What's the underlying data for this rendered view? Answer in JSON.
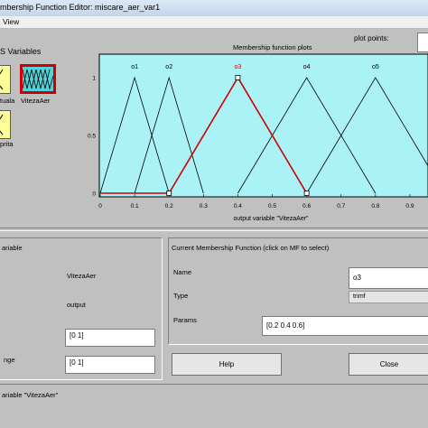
{
  "window": {
    "title": "mbership Function Editor: miscare_aer_var1"
  },
  "menu": {
    "items": [
      {
        "label": "View"
      }
    ]
  },
  "variables_panel": {
    "title": "S Variables",
    "vars": [
      {
        "label": "tuala",
        "type": "input"
      },
      {
        "label": "VitezaAer",
        "type": "output",
        "selected": true
      },
      {
        "label": "prita",
        "type": "input"
      }
    ]
  },
  "plot": {
    "title": "Membership function plots",
    "plot_points_label": "plot points:",
    "xlabel": "output variable \"VitezaAer\"",
    "x_ticks": [
      "0",
      "0.1",
      "0.2",
      "0.3",
      "0.4",
      "0.5",
      "0.6",
      "0.7",
      "0.8",
      "0.9"
    ],
    "y_ticks": [
      "1",
      "0.5",
      "0"
    ]
  },
  "chart_data": {
    "type": "line",
    "xlim": [
      0,
      0.95
    ],
    "ylim": [
      0,
      1
    ],
    "xlabel": "output variable \"VitezaAer\"",
    "series": [
      {
        "name": "o1",
        "x": [
          0,
          0.1,
          0.2
        ],
        "y": [
          0,
          1,
          0
        ],
        "color": "#000000"
      },
      {
        "name": "o2",
        "x": [
          0.1,
          0.2,
          0.3
        ],
        "y": [
          0,
          1,
          0
        ],
        "color": "#000000"
      },
      {
        "name": "o3",
        "x": [
          0.2,
          0.4,
          0.6
        ],
        "y": [
          0,
          1,
          0
        ],
        "color": "#cc0000",
        "selected": true
      },
      {
        "name": "o4",
        "x": [
          0.4,
          0.6,
          0.8
        ],
        "y": [
          0,
          1,
          0
        ],
        "color": "#000000"
      },
      {
        "name": "o5",
        "x": [
          0.6,
          0.8,
          1.0
        ],
        "y": [
          0,
          1,
          0
        ],
        "color": "#000000"
      }
    ],
    "baseline_selected": {
      "x": [
        0,
        0.2
      ],
      "color": "#cc0000"
    }
  },
  "current_variable": {
    "title": "ariable",
    "name_value": "VitezaAer",
    "type_value": "output",
    "params_value": "[0 1]",
    "range_label": "nge",
    "range_value": "[0 1]"
  },
  "current_mf": {
    "title": "Current Membership Function (click on MF to select)",
    "name_label": "Name",
    "name_value": "o3",
    "type_label": "Type",
    "type_value": "trimf",
    "params_label": "Params",
    "params_value": "[0.2 0.4 0.6]"
  },
  "buttons": {
    "help": "Help",
    "close": "Close"
  },
  "status": {
    "text": "ariable \"VitezaAer\""
  }
}
